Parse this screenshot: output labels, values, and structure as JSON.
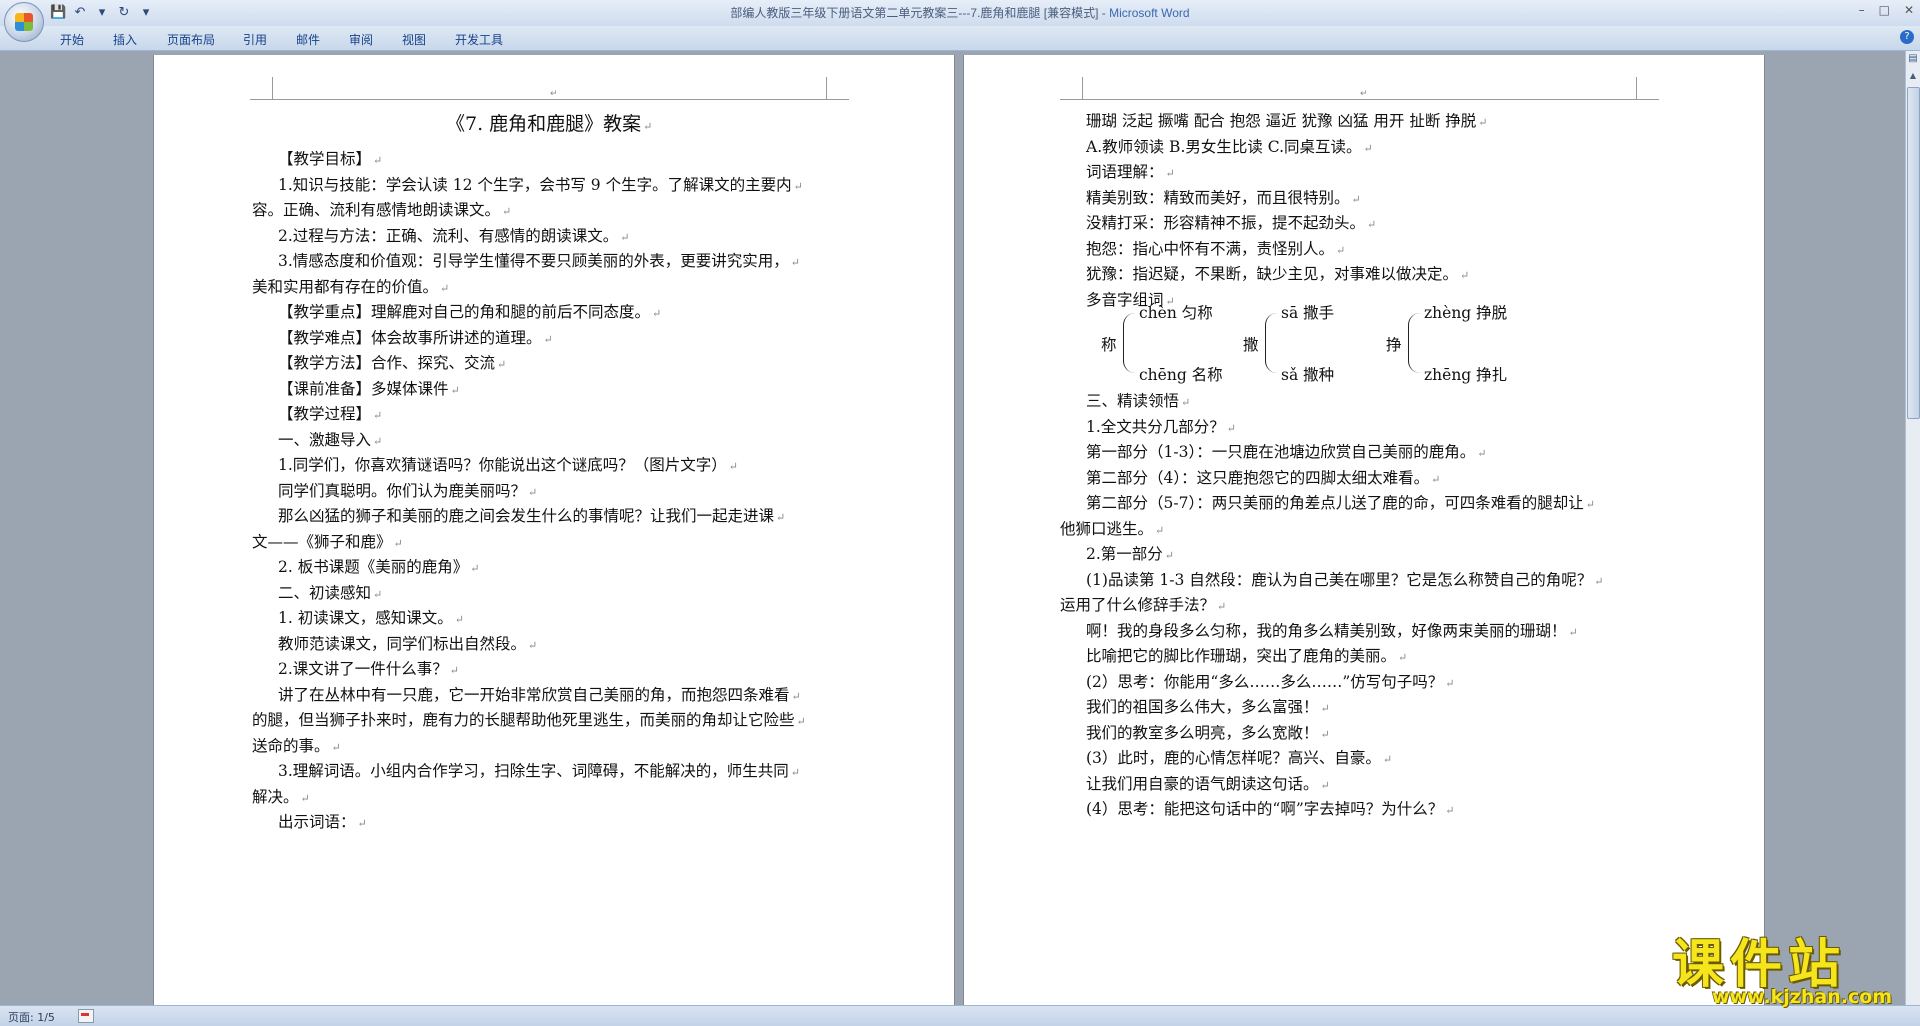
{
  "window": {
    "title_doc": "部编人教版三年级下册语文第二单元教案三---7.鹿角和鹿腿 [兼容模式] - ",
    "title_app": "Microsoft Word",
    "controls": [
      "–",
      "□",
      "✕"
    ]
  },
  "ribbon": {
    "tabs": [
      "开始",
      "插入",
      "页面布局",
      "引用",
      "邮件",
      "审阅",
      "视图",
      "开发工具"
    ],
    "help": "?"
  },
  "left_page": {
    "title": "《7. 鹿角和鹿腿》教案",
    "lines": [
      "【教学目标】",
      "1.知识与技能：学会认读 12 个生字，会书写 9 个生字。了解课文的主要内",
      "容。正确、流利有感情地朗读课文。",
      "2.过程与方法：正确、流利、有感情的朗读课文。",
      "3.情感态度和价值观：引导学生懂得不要只顾美丽的外表，更要讲究实用，",
      "美和实用都有存在的价值。",
      "【教学重点】理解鹿对自己的角和腿的前后不同态度。",
      "【教学难点】体会故事所讲述的道理。",
      "【教学方法】合作、探究、交流",
      "【课前准备】多媒体课件",
      "【教学过程】",
      "一、激趣导入",
      "1.同学们，你喜欢猜谜语吗？你能说出这个谜底吗？（图片文字）",
      "同学们真聪明。你们认为鹿美丽吗？",
      "那么凶猛的狮子和美丽的鹿之间会发生什么的事情呢？让我们一起走进课",
      "文——《狮子和鹿》",
      " 2.  板书课题《美丽的鹿角》",
      "二、初读感知",
      " 1.  初读课文，感知课文。",
      "教师范读课文，同学们标出自然段。",
      " 2.课文讲了一件什么事？",
      "讲了在丛林中有一只鹿，它一开始非常欣赏自己美丽的角，而抱怨四条难看",
      "的腿，但当狮子扑来时，鹿有力的长腿帮助他死里逃生，而美丽的角却让它险些",
      "送命的事。",
      "3.理解词语。小组内合作学习，扫除生字、词障碍，不能解决的，师生共同",
      "解决。",
      "出示词语："
    ]
  },
  "right_page": {
    "lines_top": [
      "珊瑚    泛起    撅嘴   配合  抱怨    逼近  犹豫    凶猛     用开    扯断    挣脱",
      "A.教师领读    B.男女生比读     C.同桌互读。",
      "词语理解：",
      "精美别致：精致而美好，而且很特别。",
      "没精打采：形容精神不振，提不起劲头。",
      "抱怨：指心中怀有不满，责怪别人。",
      "犹豫：指迟疑，不果断，缺少主见，对事难以做决定。",
      "多音字组词"
    ],
    "polyphones": [
      {
        "char": "称",
        "top": "chèn 匀称",
        "bottom": "chēng 名称"
      },
      {
        "char": "撒",
        "top": "sā 撒手",
        "bottom": "sǎ 撒种"
      },
      {
        "char": "挣",
        "top": "zhèng 挣脱",
        "bottom": "zhēng  挣扎"
      }
    ],
    "lines_bottom": [
      "三、精读领悟",
      "1.全文共分几部分？",
      "第一部分（1-3）：一只鹿在池塘边欣赏自己美丽的鹿角。",
      "第二部分（4）：这只鹿抱怨它的四脚太细太难看。",
      "第二部分（5-7）：两只美丽的角差点儿送了鹿的命，可四条难看的腿却让",
      "他狮口逃生。",
      "2.第一部分",
      " (1)品读第 1-3 自然段：鹿认为自己美在哪里？它是怎么称赞自己的角呢？",
      "运用了什么修辞手法？",
      "啊！我的身段多么匀称，我的角多么精美别致，好像两束美丽的珊瑚！",
      " 比喻把它的脚比作珊瑚，突出了鹿角的美丽。",
      " (2）思考：你能用“多么……多么……”仿写句子吗？",
      "我们的祖国多么伟大，多么富强！",
      "我们的教室多么明亮，多么宽敞！",
      " (3）此时，鹿的心情怎样呢？高兴、自豪。",
      "让我们用自豪的语气朗读这句话。",
      " (4）思考：能把这句话中的“啊”字去掉吗？为什么？"
    ]
  },
  "status": {
    "page": "页面: 1/5"
  },
  "watermark": {
    "big": "课件站",
    "small": "www.kjzhan.com"
  }
}
